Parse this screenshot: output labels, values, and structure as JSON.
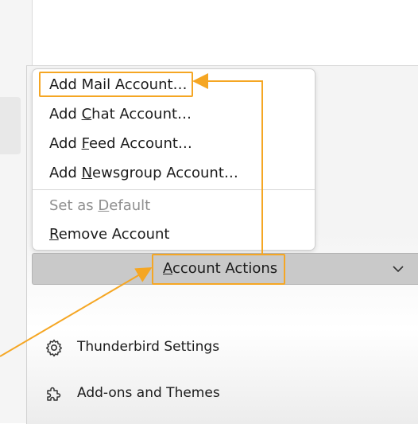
{
  "menu": {
    "items": [
      {
        "label": "Add Mail Account…",
        "disabled": false
      },
      {
        "pre": "Add ",
        "key": "C",
        "post": "hat Account…",
        "disabled": false
      },
      {
        "pre": "Add ",
        "key": "F",
        "post": "eed Account…",
        "disabled": false
      },
      {
        "pre": "Add ",
        "key": "N",
        "post": "ewsgroup Account…",
        "disabled": false
      },
      {
        "pre": "Set as ",
        "key": "D",
        "post": "efault",
        "disabled": true
      },
      {
        "pre": "",
        "key": "R",
        "post": "emove Account",
        "disabled": false
      }
    ]
  },
  "account_actions": {
    "key": "A",
    "rest": "ccount Actions",
    "chevron_icon": "chevron-down-icon"
  },
  "settings": {
    "thunderbird_settings": {
      "label": "Thunderbird Settings",
      "icon": "gear-icon"
    },
    "addons_themes": {
      "label": "Add-ons and Themes",
      "icon": "puzzle-piece-icon"
    }
  },
  "annotation": {
    "color": "#f5a623"
  }
}
